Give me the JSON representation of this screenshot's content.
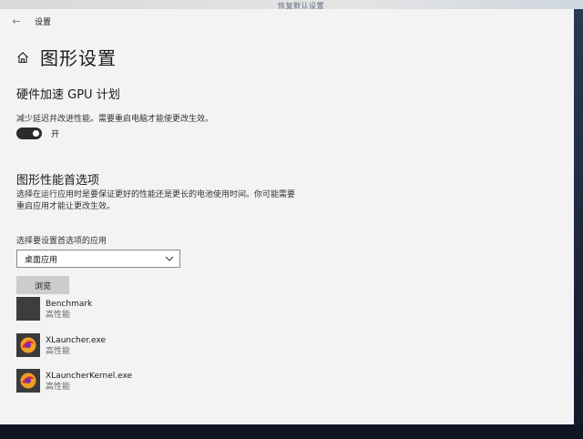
{
  "background": {
    "top_text": "恢复默认设置"
  },
  "window": {
    "title": "设置"
  },
  "page": {
    "title": "图形设置"
  },
  "gpu_section": {
    "heading": "硬件加速 GPU 计划",
    "description": "减少延迟并改进性能。需要重启电脑才能使更改生效。",
    "toggle_state": "开",
    "toggle_on": true
  },
  "perf_section": {
    "heading": "图形性能首选项",
    "description": "选择在运行应用时是要保证更好的性能还是更长的电池使用时间。你可能需要重启应用才能让更改生效。",
    "select_label": "选择要设置首选项的应用",
    "select_value": "桌面应用",
    "browse_label": "浏览"
  },
  "apps": [
    {
      "name": "Benchmark",
      "status": "高性能",
      "icon": "blank-app-icon"
    },
    {
      "name": "XLauncher.exe",
      "status": "高性能",
      "icon": "xlauncher-icon"
    },
    {
      "name": "XLauncherKernel.exe",
      "status": "高性能",
      "icon": "xlauncher-icon"
    }
  ],
  "colors": {
    "toggle_on": "#2b2b2b",
    "window_bg": "#f3f3f3",
    "button_bg": "#cccccc"
  }
}
